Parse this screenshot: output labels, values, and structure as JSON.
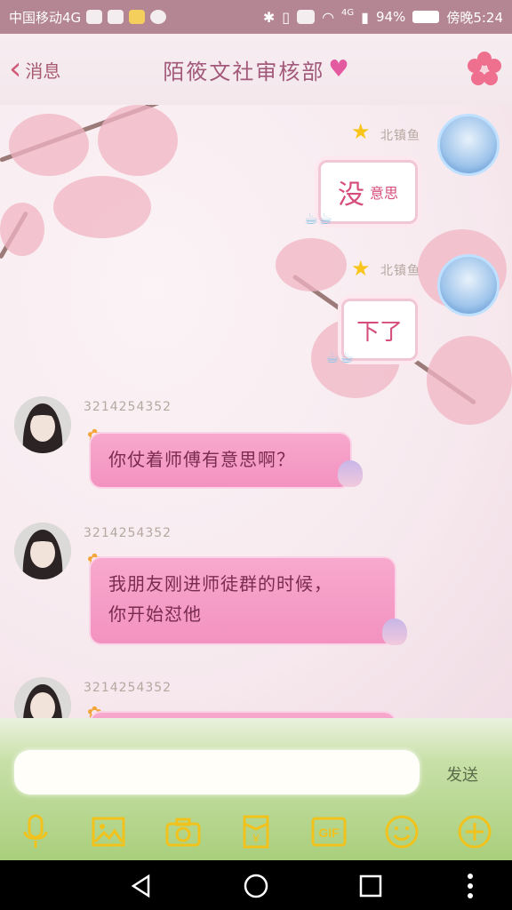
{
  "status_bar": {
    "carrier": "中国移动4G",
    "network": "4G",
    "battery": "94%",
    "time": "傍晚5:24"
  },
  "header": {
    "back_label": "消息",
    "title": "陌筱文社审核部"
  },
  "messages": [
    {
      "side": "right",
      "sender": "北镇鱼",
      "text": "没",
      "small": "意思",
      "type": "sticker-card"
    },
    {
      "side": "right",
      "sender": "北镇鱼",
      "text": "下了",
      "small": "",
      "type": "sticker-card"
    },
    {
      "side": "left",
      "sender": "3214254352",
      "text": "你仗着师傅有意思啊？",
      "type": "bubble"
    },
    {
      "side": "left",
      "sender": "3214254352",
      "text_lines": [
        "我朋友刚进师徒群的时候，",
        "你开始怼他"
      ],
      "type": "bubble"
    },
    {
      "side": "left",
      "sender": "3214254352",
      "text": "",
      "type": "bubble-partial"
    }
  ],
  "input": {
    "placeholder": "",
    "send_label": "发送"
  },
  "toolbar": {
    "icons": [
      "microphone-icon",
      "image-icon",
      "camera-icon",
      "red-packet-icon",
      "gif-icon",
      "emoji-icon",
      "plus-icon"
    ],
    "gif_label": "GIF",
    "yuan_label": "¥"
  },
  "colors": {
    "status_bar": "#b48593",
    "accent_pink": "#f392c0",
    "title": "#a35a7a",
    "toolbar_icon": "#f2c21c"
  }
}
